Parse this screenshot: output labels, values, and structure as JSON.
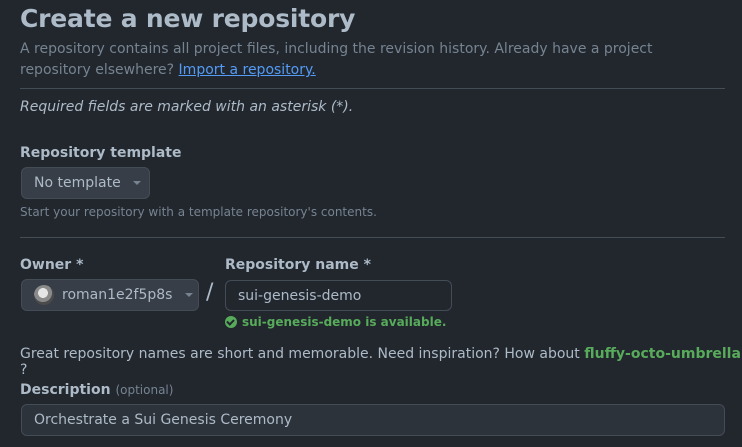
{
  "page": {
    "title": "Create a new repository",
    "intro_text": "A repository contains all project files, including the revision history. Already have a project repository elsewhere?",
    "import_link": "Import a repository.",
    "required_note": "Required fields are marked with an asterisk (*)."
  },
  "template": {
    "label": "Repository template",
    "selected": "No template",
    "hint": "Start your repository with a template repository's contents."
  },
  "owner": {
    "label": "Owner *",
    "selected": "roman1e2f5p8s"
  },
  "separator": "/",
  "repo_name": {
    "label": "Repository name *",
    "value": "sui-genesis-demo",
    "availability": "sui-genesis-demo is available."
  },
  "suggestion": {
    "prefix": "Great repository names are short and memorable. Need inspiration? How about",
    "name": "fluffy-octo-umbrella",
    "suffix": "?"
  },
  "description": {
    "label": "Description",
    "optional": "(optional)",
    "value": "Orchestrate a Sui Genesis Ceremony"
  },
  "colors": {
    "background": "#22272e",
    "text": "#adbac7",
    "muted": "#768390",
    "link": "#539bf5",
    "success": "#57ab5a",
    "border": "#444c56"
  },
  "icons": [
    "caret-down-icon",
    "avatar",
    "check-circle-icon"
  ]
}
